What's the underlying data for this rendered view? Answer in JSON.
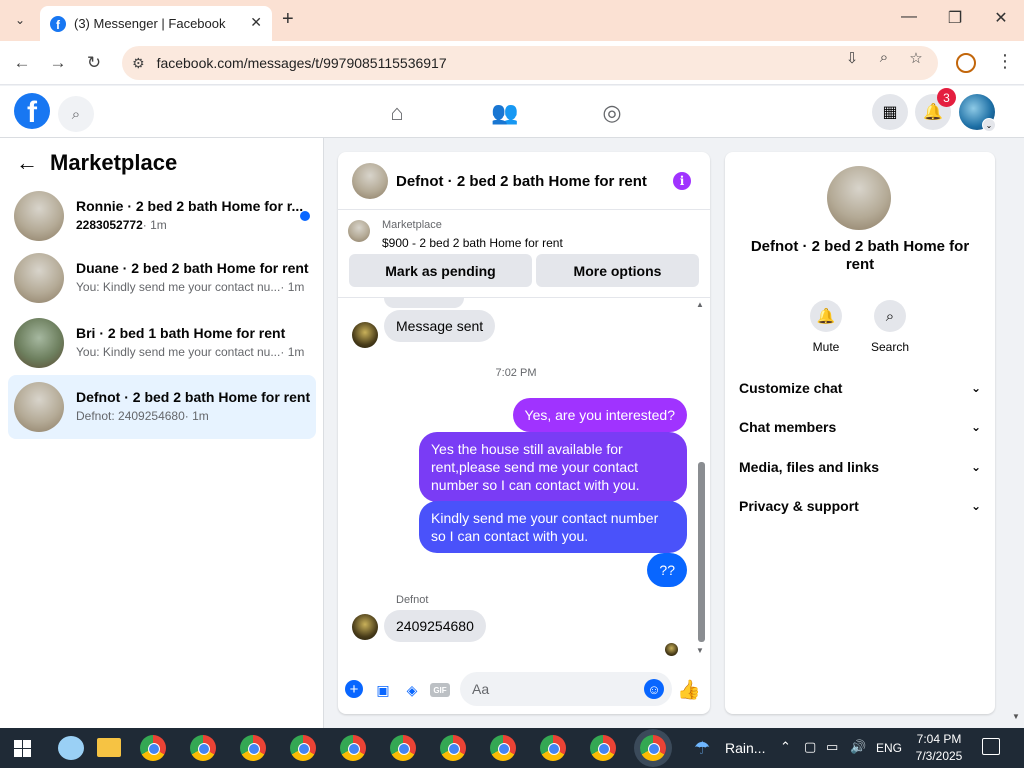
{
  "browser": {
    "tab_title": "(3) Messenger | Facebook",
    "url": "facebook.com/messages/t/9979085115536917"
  },
  "fb_header": {
    "notification_count": "3"
  },
  "sidebar": {
    "title": "Marketplace",
    "conversations": [
      {
        "title": "Ronnie · 2 bed 2 bath Home for r...",
        "subtitle": "2283052772",
        "time": "· 1m",
        "unread": true
      },
      {
        "title": "Duane · 2 bed 2 bath Home for rent",
        "subtitle": "You: Kindly send me your contact nu...",
        "time": "· 1m"
      },
      {
        "title": "Bri · 2 bed 1 bath Home for rent",
        "subtitle": "You: Kindly send me your contact nu...",
        "time": "· 1m"
      },
      {
        "title": "Defnot · 2 bed 2 bath Home for rent",
        "subtitle": "Defnot: 2409254680",
        "time": "· 1m",
        "active": true
      }
    ]
  },
  "chat": {
    "name": "Defnot · 2 bed 2 bath Home for rent",
    "marketplace_label": "Marketplace",
    "listing": "$900 - 2 bed 2 bath Home for rent",
    "mark_pending": "Mark as pending",
    "more_options": "More options",
    "messages": {
      "sent_status": "Message sent",
      "time_separator": "7:02 PM",
      "out_1": "Yes, are you interested?",
      "out_2": "Yes the house still available for rent,please send me your contact number so I can contact with you.",
      "out_3": "Kindly  send me your contact number so I can contact with you.",
      "out_4": "??",
      "sender": "Defnot",
      "in_1": "2409254680"
    },
    "composer_placeholder": "Aa",
    "gif_label": "GIF"
  },
  "right_panel": {
    "name": "Defnot · 2 bed 2 bath Home for rent",
    "mute_label": "Mute",
    "search_label": "Search",
    "sections": [
      "Customize chat",
      "Chat members",
      "Media, files and links",
      "Privacy & support"
    ]
  },
  "taskbar": {
    "weather": "Rain...",
    "language": "ENG",
    "time": "7:04 PM",
    "date": "7/3/2025"
  },
  "colors": {
    "brand": "#1877f2",
    "outgoing_bubble_top": "#a033ff",
    "outgoing_bubble_bottom": "#0866ff",
    "active_row": "#e7f3ff",
    "tabbar": "#fbe1d3"
  }
}
